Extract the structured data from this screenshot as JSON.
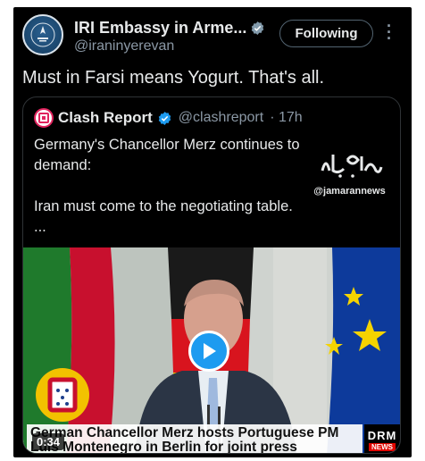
{
  "post": {
    "author_name": "IRI Embassy in Arme...",
    "author_handle": "@iraninyerevan",
    "follow_label": "Following",
    "text": "Must in Farsi means Yogurt. That's all."
  },
  "quote": {
    "author_name": "Clash Report",
    "author_handle": "@clashreport",
    "time": "· 17h",
    "text_line1": "Germany's Chancellor Merz continues to demand:",
    "text_line2": "Iran must come to the negotiating table.",
    "text_line3": "...",
    "watermark_handle": "@jamarannews"
  },
  "video": {
    "duration": "0:34",
    "caption": "German Chancellor Merz hosts Portuguese PM Luís Montenegro in Berlin for joint press conference",
    "channel_logo": "DRM",
    "channel_logo_sub": "NEWS"
  },
  "colors": {
    "background": "#000000",
    "text": "#e7e9ea",
    "muted": "#8b98a5",
    "verified": "#1d9bf0",
    "border": "#2f3336"
  },
  "icons": {
    "verified_gray": "verified-badge-gray-icon",
    "verified_blue": "verified-badge-blue-icon",
    "more": "more-options-icon",
    "play": "play-icon"
  }
}
